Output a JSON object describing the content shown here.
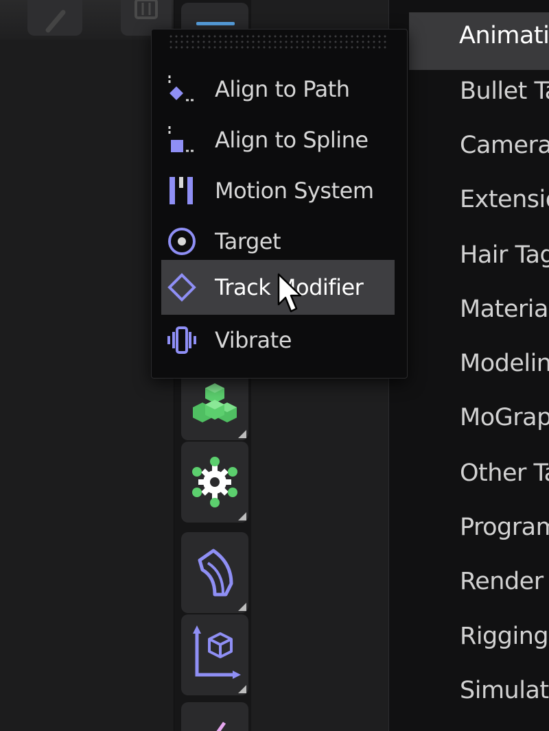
{
  "popup": {
    "items": [
      {
        "label": "Align to Path",
        "icon": "align-to-path-icon"
      },
      {
        "label": "Align to Spline",
        "icon": "align-to-spline-icon"
      },
      {
        "label": "Motion System",
        "icon": "motion-system-icon"
      },
      {
        "label": "Target",
        "icon": "target-icon"
      },
      {
        "label": "Track Modifier",
        "icon": "track-modifier-icon",
        "hovered": true
      },
      {
        "label": "Vibrate",
        "icon": "vibrate-icon"
      }
    ]
  },
  "category_menu": {
    "items": [
      {
        "label": "Animatio",
        "active": true
      },
      {
        "label": "Bullet Ta"
      },
      {
        "label": "Camera"
      },
      {
        "label": "Extensio"
      },
      {
        "label": "Hair Tag"
      },
      {
        "label": "Material"
      },
      {
        "label": "Modelin"
      },
      {
        "label": "MoGrap"
      },
      {
        "label": "Other Ta"
      },
      {
        "label": "Program"
      },
      {
        "label": "Render T"
      },
      {
        "label": "Rigging"
      },
      {
        "label": "Simulati"
      }
    ]
  },
  "palette": {
    "tools": [
      {
        "icon": "cubes-icon",
        "color": "#5ccf6e"
      },
      {
        "icon": "gear-icon",
        "color": "#5ccf6e"
      },
      {
        "icon": "deformer-shape-icon",
        "color": "#8f8ff5"
      },
      {
        "icon": "axis-cube-icon",
        "color": "#8f8ff5"
      }
    ]
  },
  "colors": {
    "accent_purple": "#8f8ff5",
    "accent_green": "#5ccf6e",
    "accent_blue": "#5aa6e8"
  }
}
